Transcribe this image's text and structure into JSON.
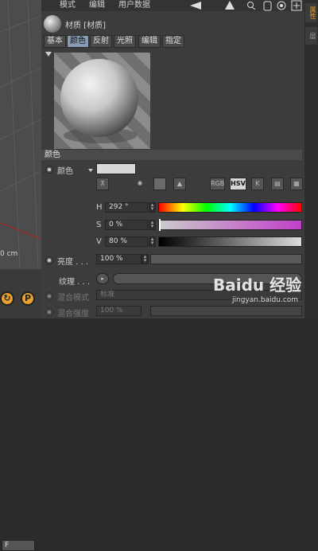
{
  "menubar": {
    "items": [
      "模式",
      "编辑",
      "用户数据"
    ]
  },
  "toolbar": {
    "icons": [
      "arrow-left-icon",
      "arrow-up-icon",
      "search-icon",
      "lock-icon",
      "target-icon",
      "add-icon"
    ]
  },
  "object": {
    "title": "材质 [材质]"
  },
  "tabs": [
    {
      "label": "基本",
      "active": false
    },
    {
      "label": "颜色",
      "active": true
    },
    {
      "label": "反射",
      "active": false
    },
    {
      "label": "光照",
      "active": false
    },
    {
      "label": "编辑",
      "active": false
    },
    {
      "label": "指定",
      "active": false
    }
  ],
  "section": {
    "title": "颜色"
  },
  "color": {
    "label": "颜色",
    "swatch": "#d8d8d8",
    "mode_buttons": [
      "RGB",
      "HSV",
      "K"
    ],
    "active_mode": "HSV",
    "h": {
      "label": "H",
      "value": "292 °"
    },
    "s": {
      "label": "S",
      "value": "0 %"
    },
    "v": {
      "label": "V",
      "value": "80 %"
    }
  },
  "brightness": {
    "label": "亮度 . . .",
    "value": "100 %"
  },
  "texture": {
    "label": "纹理 . . ."
  },
  "mix_mode": {
    "label": "混合模式",
    "value": "标准"
  },
  "mix_strength": {
    "label": "混合强度",
    "value": "100 %"
  },
  "viewport": {
    "unit_label": "0 cm",
    "field_value": "F"
  },
  "bottom_buttons": [
    "P"
  ],
  "side_tabs": [
    "属性",
    "层"
  ],
  "watermark": {
    "brand": "Baidu 经验",
    "url": "jingyan.baidu.com"
  },
  "colors": {
    "panel_bg": "#3c3c3c",
    "active_tab": "#8a9cb4",
    "accent_orange": "#e8a030"
  }
}
